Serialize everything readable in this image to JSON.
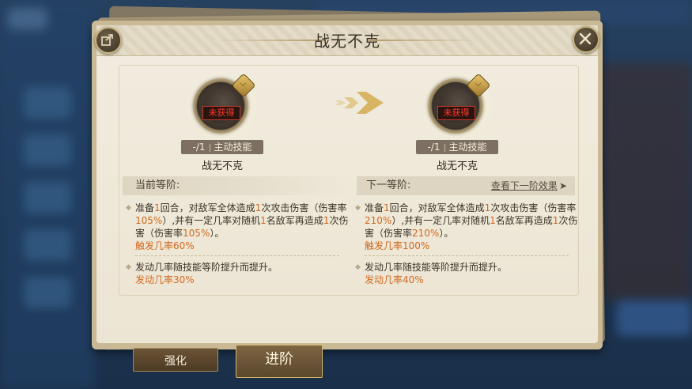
{
  "dialog": {
    "title": "战无不克",
    "share_icon": "share-icon",
    "close_icon": "close-icon"
  },
  "current_skill": {
    "lock_label": "未获得",
    "tag_level": "-/1",
    "tag_type": "主动技能",
    "name": "战无不克"
  },
  "next_skill": {
    "lock_label": "未获得",
    "tag_level": "-/1",
    "tag_type": "主动技能",
    "name": "战无不克"
  },
  "current_level": {
    "header": "当前等阶:",
    "desc1_a": "准备",
    "desc1_n1": "1",
    "desc1_b": "回合，对敌军全体造成",
    "desc1_n2": "1",
    "desc1_c": "次攻击伤害（伤害率",
    "desc1_rate": "105%",
    "desc1_d": "）,并有一定几率对随机",
    "desc1_n3": "1",
    "desc1_e": "名敌军再造成",
    "desc1_n4": "1",
    "desc1_f": "次伤害（伤害率",
    "desc1_rate2": "105%",
    "desc1_g": "）。",
    "trigger": "触发几率60%",
    "desc2": "发动几率随技能等阶提升而提升。",
    "activation": "发动几率30%"
  },
  "next_level": {
    "header": "下一等阶:",
    "view_next": "查看下一阶效果",
    "desc1_a": "准备",
    "desc1_n1": "1",
    "desc1_b": "回合，对敌军全体造成",
    "desc1_n2": "1",
    "desc1_c": "次攻击伤害（伤害率",
    "desc1_rate": "210%",
    "desc1_d": "）,并有一定几率对随机",
    "desc1_n3": "1",
    "desc1_e": "名敌军再造成",
    "desc1_n4": "1",
    "desc1_f": "次伤害（伤害率",
    "desc1_rate2": "210%",
    "desc1_g": "）。",
    "trigger": "触发几率100%",
    "desc2": "发动几率随技能等阶提升而提升。",
    "activation": "发动几率40%"
  },
  "tabs": {
    "strengthen": "强化",
    "advance": "进阶"
  },
  "colors": {
    "highlight": "#d2691e",
    "lock_red": "#ff3b2b",
    "panel_bg": "#ece5d3"
  }
}
